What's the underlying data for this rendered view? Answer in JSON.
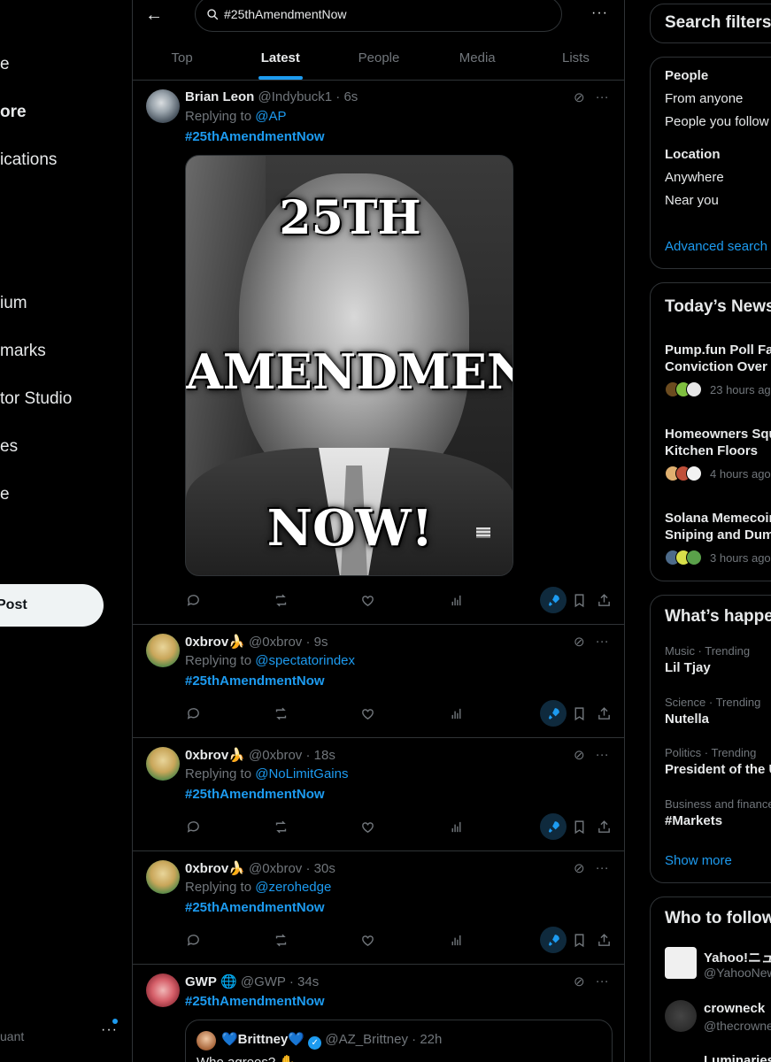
{
  "leftnav": {
    "items": [
      {
        "label": "e",
        "bold": false
      },
      {
        "label": "ore",
        "bold": true
      },
      {
        "label": "ications",
        "bold": false
      },
      {
        "label": "ium",
        "bold": false
      },
      {
        "label": "marks",
        "bold": false
      },
      {
        "label": "tor Studio",
        "bold": false
      },
      {
        "label": "es",
        "bold": false
      },
      {
        "label": "e",
        "bold": false
      }
    ],
    "post_label": "Post",
    "account_handle": "uant",
    "more_label": "···"
  },
  "topbar": {
    "back_icon": "←",
    "search_value": "#25thAmendmentNow",
    "more_icon": "···",
    "tabs": [
      "Top",
      "Latest",
      "People",
      "Media",
      "Lists"
    ],
    "active_tab": "Latest"
  },
  "tweets": [
    {
      "name": "Brian Leon",
      "handle": "@Indybuck1",
      "time": "6s",
      "replying_label": "Replying to",
      "replying_to": "@AP",
      "hashtag": "#25thAmendmentNow",
      "media_text": [
        "25TH",
        "AMENDMENT",
        "NOW!"
      ]
    },
    {
      "name": "0xbrov🍌",
      "handle": "@0xbrov",
      "time": "9s",
      "replying_label": "Replying to",
      "replying_to": "@spectatorindex",
      "hashtag": "#25thAmendmentNow"
    },
    {
      "name": "0xbrov🍌",
      "handle": "@0xbrov",
      "time": "18s",
      "replying_label": "Replying to",
      "replying_to": "@NoLimitGains",
      "hashtag": "#25thAmendmentNow"
    },
    {
      "name": "0xbrov🍌",
      "handle": "@0xbrov",
      "time": "30s",
      "replying_label": "Replying to",
      "replying_to": "@zerohedge",
      "hashtag": "#25thAmendmentNow"
    },
    {
      "name": "GWP",
      "name_badge": "🌐",
      "handle": "@GWP",
      "time": "34s",
      "hashtag": "#25thAmendmentNow",
      "quote": {
        "name": "💙Brittney💙",
        "handle": "@AZ_Brittney",
        "time": "22h",
        "text": "Who agrees? ✋"
      }
    }
  ],
  "right": {
    "filters": {
      "title": "Search filters",
      "people_title": "People",
      "people_options": [
        "From anyone",
        "People you follow"
      ],
      "location_title": "Location",
      "location_options": [
        "Anywhere",
        "Near you"
      ],
      "advanced_link": "Advanced search"
    },
    "news": {
      "title": "Today’s News",
      "items": [
        {
          "line1": "Pump.fun Poll Favo",
          "line2": "Conviction Over Fa",
          "time": "23 hours ago"
        },
        {
          "line1": "Homeowners Squi",
          "line2": "Kitchen Floors",
          "time": "4 hours ago"
        },
        {
          "line1": "Solana Memecoin",
          "line2": "Sniping and Dump",
          "time": "3 hours ago"
        }
      ]
    },
    "happening": {
      "title": "What’s happe",
      "items": [
        {
          "context": "Music · Trending",
          "topic": "Lil Tjay"
        },
        {
          "context": "Science · Trending",
          "topic": "Nutella"
        },
        {
          "context": "Politics · Trending",
          "topic": "President of the U"
        },
        {
          "context": "Business and finance",
          "topic": "#Markets"
        }
      ],
      "show_more": "Show more"
    },
    "follow": {
      "title": "Who to follow",
      "items": [
        {
          "name": "Yahoo!ニュ",
          "handle": "@YahooNew"
        },
        {
          "name": "crowneck",
          "handle": "@thecrowne"
        },
        {
          "name": "Luminaries",
          "handle": ""
        }
      ]
    }
  },
  "colors": {
    "accent": "#1d9bf0",
    "background": "#000000",
    "border": "#2f3336",
    "muted": "#71767b",
    "text": "#e7e9ea"
  }
}
